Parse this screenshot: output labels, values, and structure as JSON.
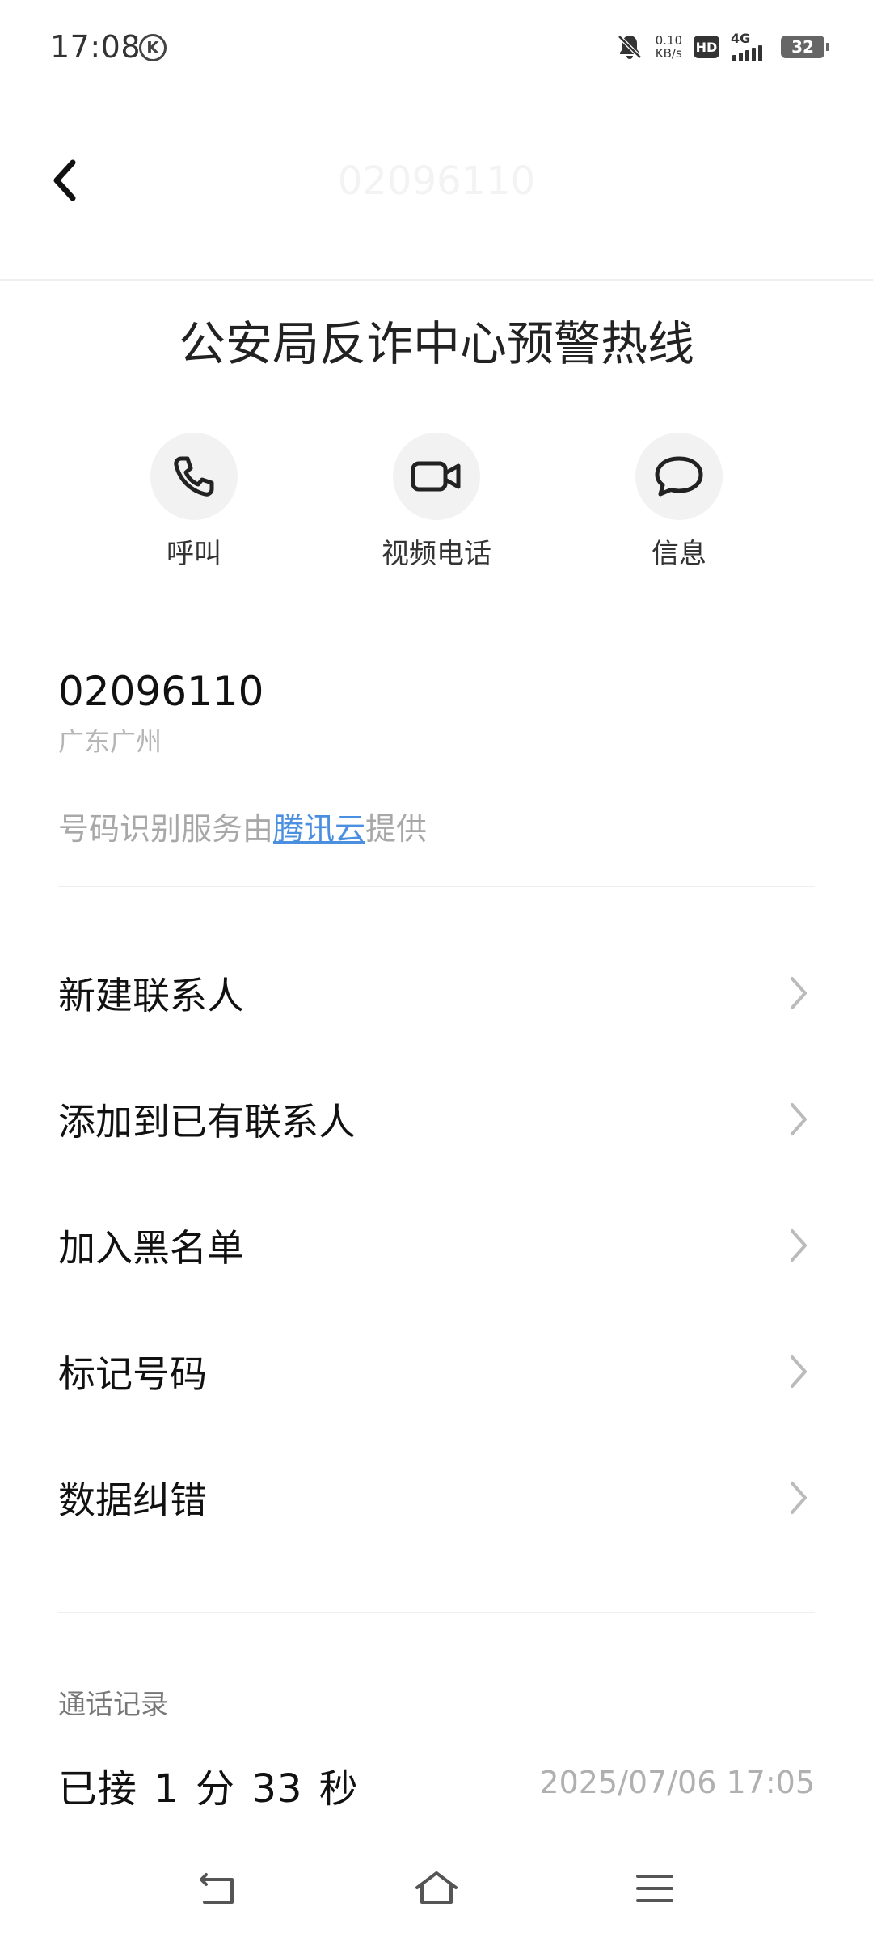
{
  "status_bar": {
    "time": "17:08",
    "k_badge": "K",
    "net_speed_value": "0.10",
    "net_speed_unit": "KB/s",
    "hd_label": "HD",
    "signal_label": "4G",
    "battery_level": "32"
  },
  "header": {
    "title": "02096110"
  },
  "contact": {
    "name": "公安局反诈中心预警热线"
  },
  "actions": [
    {
      "label": "呼叫",
      "icon": "phone-icon"
    },
    {
      "label": "视频电话",
      "icon": "video-camera-icon"
    },
    {
      "label": "信息",
      "icon": "message-bubble-icon"
    }
  ],
  "number_info": {
    "number": "02096110",
    "location": "广东广州",
    "provider_prefix": "号码识别服务由",
    "provider_link": "腾讯云",
    "provider_suffix": "提供"
  },
  "menu": [
    {
      "label": "新建联系人"
    },
    {
      "label": "添加到已有联系人"
    },
    {
      "label": "加入黑名单"
    },
    {
      "label": "标记号码"
    },
    {
      "label": "数据纠错"
    }
  ],
  "call_log": {
    "title": "通话记录",
    "status": "已接 1 分 33 秒",
    "datetime": "2025/07/06 17:05"
  },
  "nav_bar": {
    "back_icon": "back-icon",
    "home_icon": "home-icon",
    "menu_icon": "menu-icon"
  },
  "colors": {
    "accent_link": "#4a8fe0",
    "text_primary": "#111111",
    "text_secondary": "#a8a8a8"
  }
}
